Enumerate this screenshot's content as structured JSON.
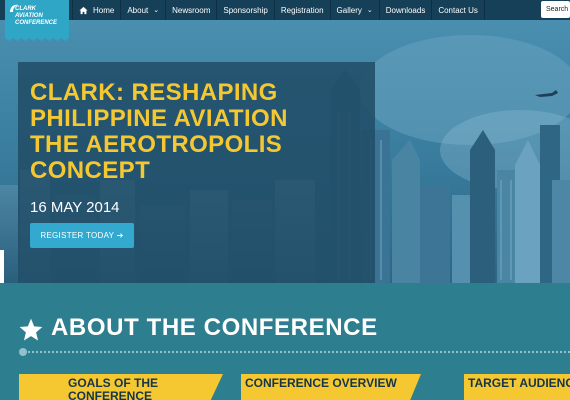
{
  "logo": {
    "line1": "CLARK",
    "line2": "AVIATION",
    "line3": "CONFERENCE"
  },
  "nav": {
    "items": [
      {
        "label": "Home",
        "icon": "home-icon"
      },
      {
        "label": "About",
        "has_dropdown": true
      },
      {
        "label": "Newsroom"
      },
      {
        "label": "Sponsorship"
      },
      {
        "label": "Registration"
      },
      {
        "label": "Gallery",
        "has_dropdown": true
      },
      {
        "label": "Downloads"
      },
      {
        "label": "Contact Us"
      }
    ],
    "caret": "⌄"
  },
  "search": {
    "placeholder": "Search"
  },
  "hero": {
    "title_lines": [
      "CLARK: RESHAPING",
      "PHILIPPINE AVIATION",
      "THE AEROTROPOLIS",
      "CONCEPT"
    ],
    "date": "16 MAY 2014",
    "register_label": "REGISTER TODAY ➔"
  },
  "about": {
    "heading": "ABOUT THE CONFERENCE",
    "cards": [
      {
        "label": "GOALS OF THE CONFERENCE"
      },
      {
        "label": "CONFERENCE OVERVIEW"
      },
      {
        "label": "TARGET AUDIENCE"
      }
    ]
  },
  "colors": {
    "nav_bg": "#163f58",
    "logo_bg": "#2fa6c6",
    "accent_yellow": "#f5c831",
    "button_blue": "#33a9cf",
    "section_bg": "#2d7e8f"
  }
}
